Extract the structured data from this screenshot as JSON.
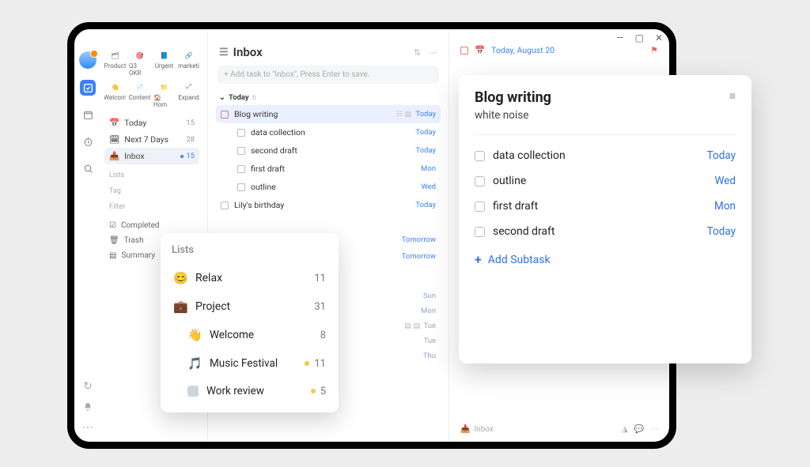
{
  "window": {
    "min": "—",
    "max": "▢",
    "close": "✕"
  },
  "rail": {},
  "pinned": {
    "row1": [
      {
        "label": "Product",
        "icon": "🗂"
      },
      {
        "label": "Q3 OKR",
        "icon": "🎯"
      },
      {
        "label": "Urgent",
        "icon": "📘"
      },
      {
        "label": "marketi",
        "icon": "🔗"
      }
    ],
    "row2": [
      {
        "label": "Welcom",
        "icon": "👋"
      },
      {
        "label": "Content",
        "icon": "📄"
      },
      {
        "label": "🏠 Hom",
        "icon": "📁"
      },
      {
        "label": "Expand",
        "icon": "⤢"
      }
    ]
  },
  "smart": {
    "today": {
      "label": "Today",
      "count": "15"
    },
    "next7": {
      "label": "Next 7 Days",
      "count": "28"
    },
    "inbox": {
      "label": "Inbox",
      "count": "15"
    }
  },
  "sections": {
    "lists": "Lists",
    "tag": "Tag",
    "filter": "Filter"
  },
  "bottom": {
    "completed": "Completed",
    "trash": "Trash",
    "summary": "Summary"
  },
  "main": {
    "title": "Inbox",
    "add_placeholder": "+ Add task to \"Inbox\", Press Enter to save.",
    "group": {
      "label": "Today",
      "count": "6"
    },
    "tasks": [
      {
        "title": "Blog writing",
        "due": "Today",
        "selected": true,
        "indent": 0
      },
      {
        "title": "data collection",
        "due": "Today",
        "indent": 1
      },
      {
        "title": "second draft",
        "due": "Today",
        "indent": 1
      },
      {
        "title": "first draft",
        "due": "Mon",
        "indent": 1
      },
      {
        "title": "outline",
        "due": "Wed",
        "indent": 1
      },
      {
        "title": "Lily's birthday",
        "due": "Today",
        "indent": 0
      }
    ],
    "ghost_dues_a": [
      "Tomorrow",
      "Tomorrow"
    ],
    "ghost_dues_b": [
      "Sun",
      "Mon",
      "Tue",
      "Tue",
      "Thu"
    ]
  },
  "detail": {
    "date": "Today, August 20",
    "footer_loc": "Inbox"
  },
  "lists_card": {
    "heading": "Lists",
    "items": [
      {
        "icon": "😊",
        "label": "Relax",
        "count": "11",
        "sub": false,
        "dot": false
      },
      {
        "icon": "💼",
        "label": "Project",
        "count": "31",
        "sub": false,
        "dot": false
      },
      {
        "icon": "👋",
        "label": "Welcome",
        "count": "8",
        "sub": true,
        "dot": false
      },
      {
        "icon": "🎵",
        "label": "Music Festival",
        "count": "11",
        "sub": true,
        "dot": true
      },
      {
        "icon": "□",
        "label": "Work review",
        "count": "5",
        "sub": true,
        "dot": true
      }
    ]
  },
  "detail_card": {
    "title": "Blog writing",
    "note": "white noise",
    "subtasks": [
      {
        "label": "data collection",
        "due": "Today"
      },
      {
        "label": "outline",
        "due": "Wed"
      },
      {
        "label": "first draft",
        "due": "Mon"
      },
      {
        "label": "second draft",
        "due": "Today"
      }
    ],
    "add_subtask": "Add Subtask"
  }
}
